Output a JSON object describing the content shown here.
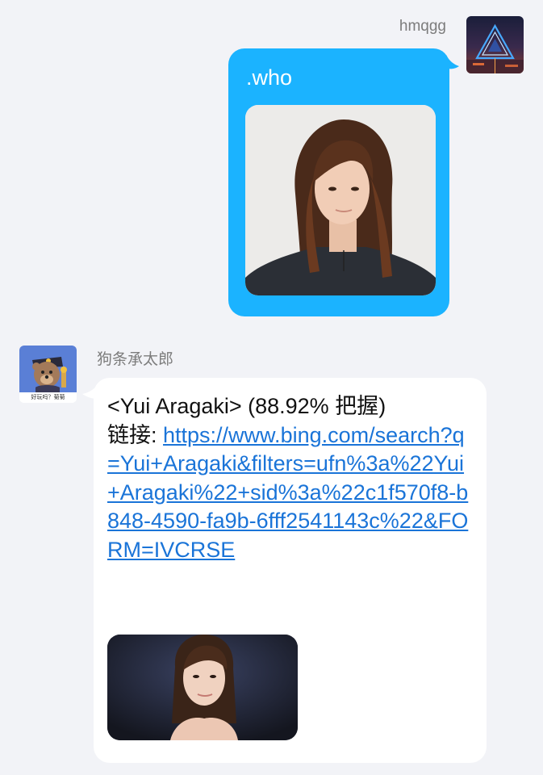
{
  "outgoing": {
    "sender_name": "hmqgg",
    "avatar_icon": "neon-triangle-avatar-icon",
    "message_text": ".who",
    "bubble_color": "#1bb3ff",
    "photo_icon": "portrait-photo-woman-long-hair"
  },
  "incoming": {
    "sender_name": "狗条承太郎",
    "avatar_icon": "cartoon-bear-avatar-icon",
    "avatar_caption": "好玩吗？菊菊",
    "result_line": "<Yui Aragaki> (88.92% 把握)",
    "link_label": "链接: ",
    "link_url": "https://www.bing.com/search?q=Yui+Aragaki&filters=ufn%3a%22Yui+Aragaki%22+sid%3a%22c1f570f8-b848-4590-fa9b-6fff2541143c%22&FORM=IVCRSE",
    "photo_icon": "portrait-photo-woman-dark-background",
    "link_color": "#1a74d8"
  }
}
